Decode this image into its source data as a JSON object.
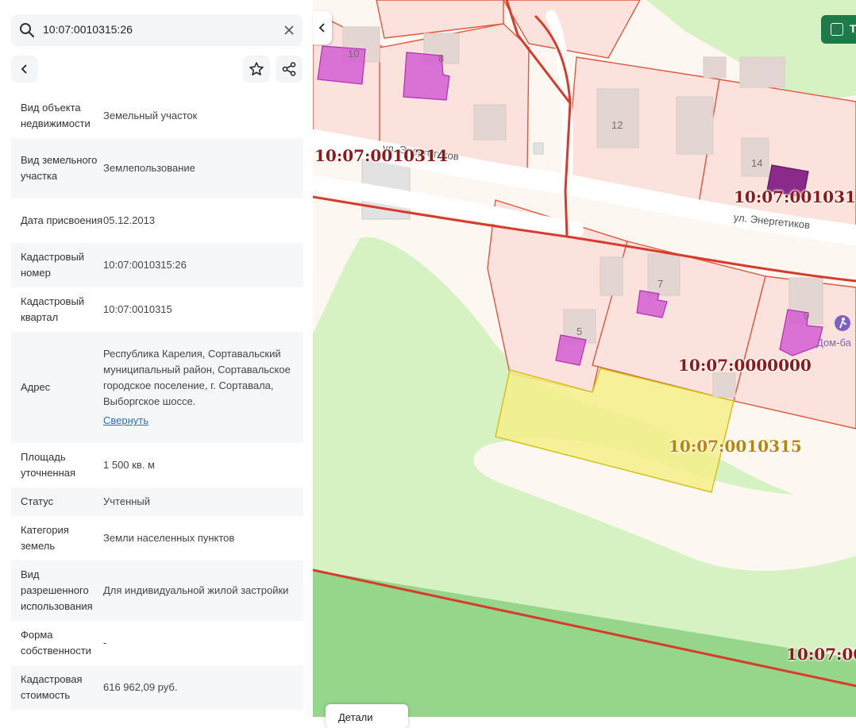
{
  "search": {
    "value": "10:07:0010315:26"
  },
  "properties": [
    {
      "label": "Вид объекта недвижимости",
      "value": "Земельный участок"
    },
    {
      "label": "Вид земельного участка",
      "value": "Землепользование"
    },
    {
      "label": "Дата присвоения",
      "value": "05.12.2013"
    },
    {
      "label": "Кадастровый номер",
      "value": "10:07:0010315:26"
    },
    {
      "label": "Кадастровый квартал",
      "value": "10:07:0010315"
    },
    {
      "label": "Адрес",
      "value": "Республика Карелия, Сортавальский муниципальный район, Сортавальское городское поселение, г. Сортавала, Выборгское шоссе."
    },
    {
      "label": "Площадь уточненная",
      "value": "1 500 кв. м"
    },
    {
      "label": "Статус",
      "value": "Учтенный"
    },
    {
      "label": "Категория земель",
      "value": "Земли населенных пунктов"
    },
    {
      "label": "Вид разрешенного использования",
      "value": "Для индивидуальной жилой застройки"
    },
    {
      "label": "Форма собственности",
      "value": "-"
    },
    {
      "label": "Кадастровая стоимость",
      "value": "616 962,09 руб."
    }
  ],
  "address_collapse": "Свернуть",
  "map": {
    "cadastral_labels": [
      "10:07:0010314",
      "10:07:001031",
      "10:07:0000000",
      "10:07:0010315",
      "10:07:00"
    ],
    "house_numbers": [
      "10",
      "8",
      "12",
      "14",
      "7",
      "5",
      "9"
    ],
    "streets": [
      "ул. Энергетиков",
      "ул. Энергетиков"
    ],
    "poi": "Дом-ба",
    "layer_button": "Т",
    "details_button": "Детали"
  },
  "colors": {
    "boundary": "#d63b2b",
    "selected_parcel": "#f5ef8a",
    "building_purple": "#d25ed2",
    "forest": "#d6f2c2",
    "dark_green": "#95d68a",
    "layer_button": "#1f7a4a"
  }
}
